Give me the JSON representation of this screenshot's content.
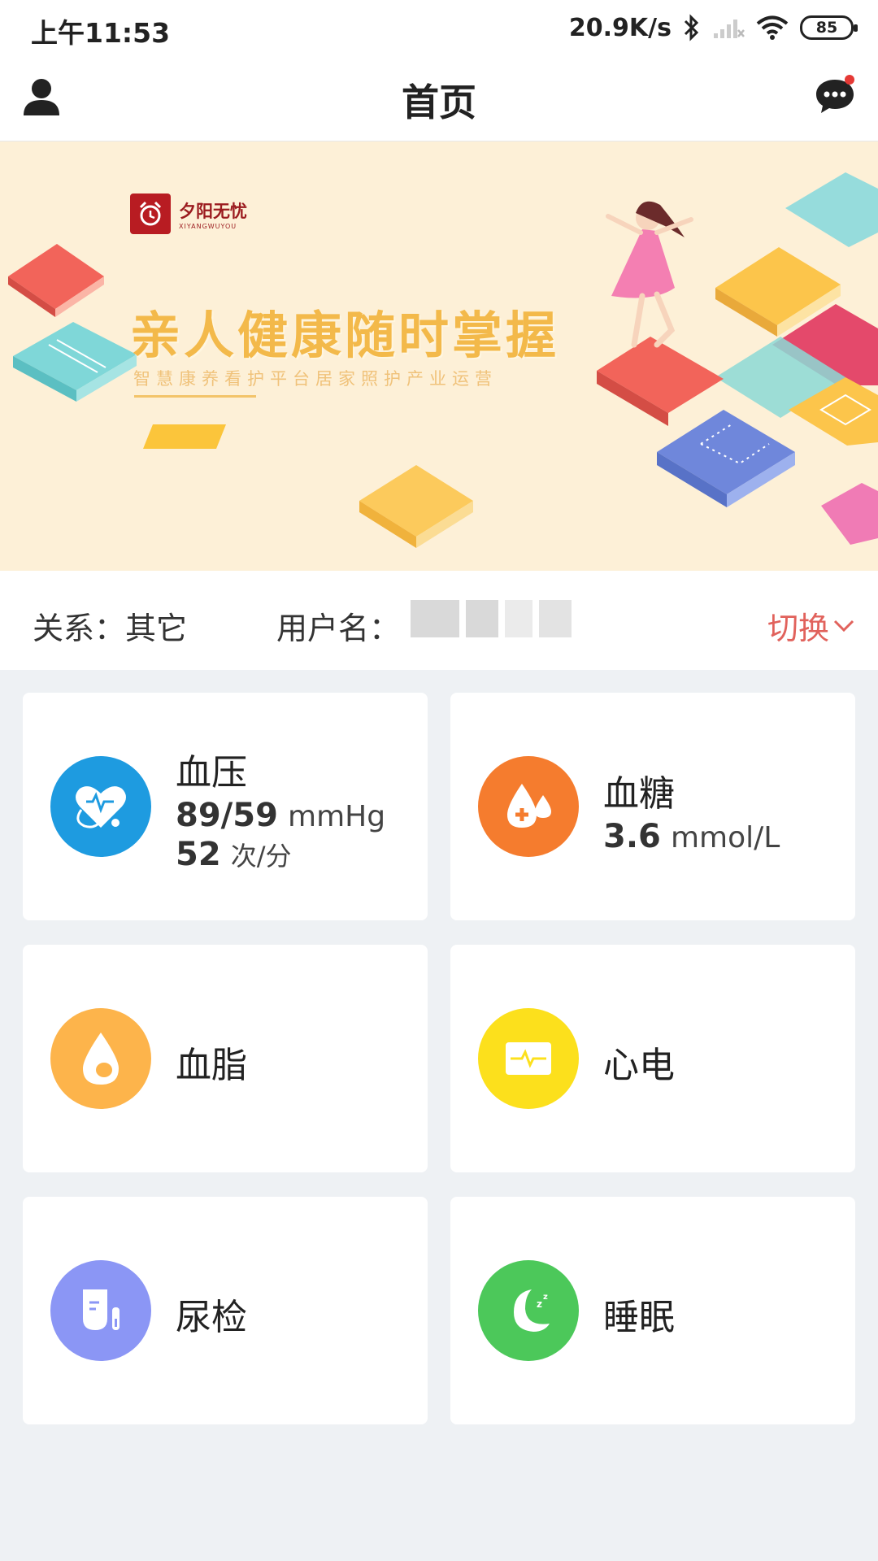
{
  "status_bar": {
    "time": "上午11:53",
    "net_speed": "20.9K/s",
    "battery": "85"
  },
  "header": {
    "title": "首页",
    "user_icon": "user-icon",
    "message_icon": "chat-bubble-icon",
    "message_badge_color": "#e53935"
  },
  "banner": {
    "logo_name": "夕阳无忧",
    "logo_sub": "XIYANGWUYOU",
    "headline": "亲人健康随时掌握",
    "subline": "智慧康养看护平台居家照护产业运营"
  },
  "relation": {
    "relation_label": "关系：其它",
    "username_label": "用户名：",
    "switch_label": "切换"
  },
  "cards": [
    {
      "title": "血压",
      "value1": "89/59",
      "unit1": "mmHg",
      "value2": "52",
      "unit2": "次/分",
      "color": "#1e9be0",
      "icon": "blood-pressure-icon"
    },
    {
      "title": "血糖",
      "value1": "3.6",
      "unit1": "mmol/L",
      "color": "#f57c2e",
      "icon": "blood-sugar-icon"
    },
    {
      "title": "血脂",
      "color": "#fdb44b",
      "icon": "blood-lipid-icon"
    },
    {
      "title": "心电",
      "color": "#fce01c",
      "icon": "ecg-icon"
    },
    {
      "title": "尿检",
      "color": "#8b96f5",
      "icon": "urine-test-icon"
    },
    {
      "title": "睡眠",
      "color": "#4cc85a",
      "icon": "sleep-icon"
    }
  ]
}
